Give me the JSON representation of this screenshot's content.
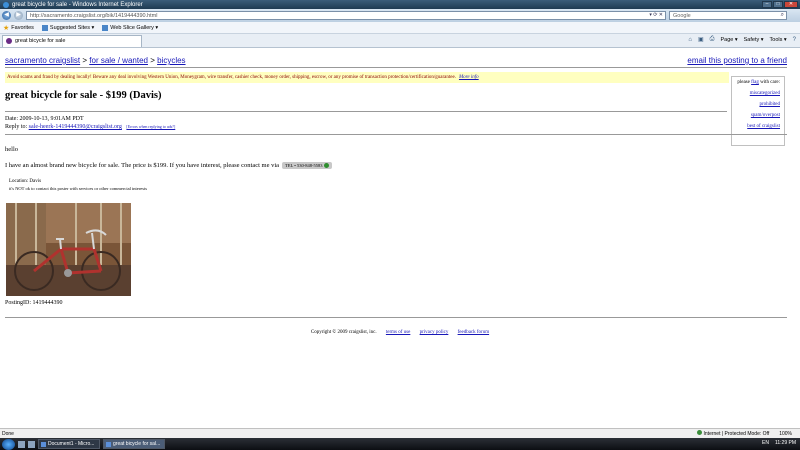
{
  "window": {
    "title": "great bicycle for sale - Windows Internet Explorer",
    "minimize": "–",
    "maximize": "□",
    "close": "✕"
  },
  "address": {
    "url": "http://sacramento.craigslist.org/bik/1419444390.html",
    "search_placeholder": "Google",
    "back_icon": "back-arrow-icon",
    "forward_icon": "forward-arrow-icon"
  },
  "favorites": {
    "label": "Favorites",
    "items": [
      "Suggested Sites ▾",
      "Web Slice Gallery ▾"
    ]
  },
  "tab": {
    "label": "great bicycle for sale"
  },
  "commands": {
    "page": "Page ▾",
    "safety": "Safety ▾",
    "tools": "Tools ▾"
  },
  "breadcrumb": {
    "site": "sacramento craigslist",
    "sep1": " > ",
    "category": "for sale / wanted",
    "sep2": " > ",
    "subcategory": "bicycles"
  },
  "email_link": "email this posting to a friend",
  "warning": {
    "text": "Avoid scams and fraud by dealing locally! Beware any deal involving Western Union, Moneygram, wire transfer, cashier check, money order, shipping, escrow, or any promise of transaction protection/certification/guarantee.",
    "more_info": "More info"
  },
  "flag": {
    "please": "please",
    "flag_word": "flag",
    "with_care": "with care:",
    "items": [
      "miscategorized",
      "prohibited",
      "spam/overpost",
      "best of craigslist"
    ]
  },
  "posting": {
    "title": "great bicycle for sale - $199 (Davis)",
    "date_label": "Date: 2009-10-13, 9:01AM PDT",
    "reply_label": "Reply to:",
    "reply_email": "sale-heerk-1419444390@craigslist.org",
    "reply_note": "[Errors when replying to ads?]",
    "greeting": "hello",
    "body": "I have an almost brand new bicycle for sale. The price is $199. If you have interest, please contact me via",
    "phone": "TEL • 530-848-5583",
    "location": "Location: Davis",
    "not_ok": "it's NOT ok to contact this poster with services or other commercial interests",
    "posting_id": "PostingID: 1419444390"
  },
  "footer": {
    "copyright": "Copyright © 2009 craigslist, inc.",
    "links": [
      "terms of use",
      "privacy policy",
      "feedback forum"
    ]
  },
  "status": {
    "left": "Done",
    "zone": "Internet | Protected Mode: Off",
    "zoom": "100%"
  },
  "taskbar": {
    "tasks": [
      "Document1 - Micro...",
      "great bicycle for sal..."
    ],
    "lang": "EN",
    "time": "11:29 PM"
  },
  "colors": {
    "link": "#1717b8",
    "warning_bg": "#ffffc0",
    "warning_text": "#8b0000"
  }
}
